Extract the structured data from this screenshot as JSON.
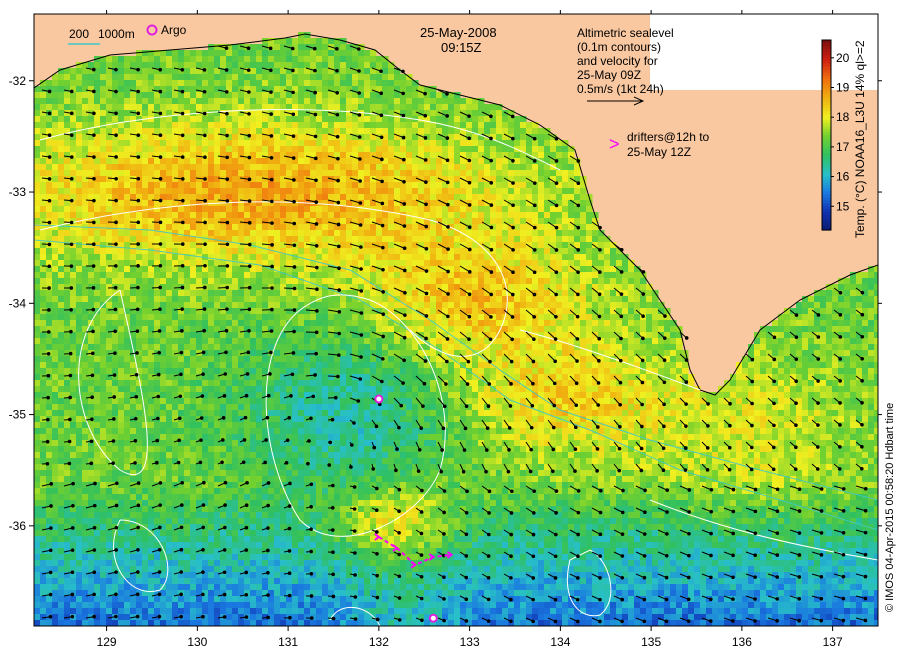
{
  "title": {
    "date": "25-May-2008",
    "time": "09:15Z"
  },
  "legend": {
    "isobaths": [
      "200",
      "1000m"
    ],
    "argo_label": "Argo",
    "altimetry_lines": [
      "Altimetric sealevel",
      "(0.1m contours)",
      "and velocity for",
      "25-May 09Z",
      "0.5m/s (1kt 24h)"
    ],
    "drifter_symbol": ">",
    "drifter_lines": [
      "drifters@12h to",
      "25-May 12Z"
    ]
  },
  "colorbar": {
    "label": "Temp. (°C) NOAA16_L3U 14% ql>=2",
    "ticks": [
      "15",
      "16",
      "17",
      "18",
      "19",
      "20"
    ],
    "min": 14.2,
    "max": 20.6
  },
  "axes": {
    "x_ticks": [
      "129",
      "130",
      "131",
      "132",
      "133",
      "134",
      "135",
      "136",
      "137"
    ],
    "y_ticks": [
      "-32",
      "-33",
      "-34",
      "-35",
      "-36"
    ],
    "lon_range": [
      128.2,
      137.5
    ],
    "lat_range": [
      -36.9,
      -31.4
    ]
  },
  "credit": "© IMOS 04-Apr-2015 00:58:20 Hdbart time",
  "colors": {
    "land": "#f9c8a0",
    "isobath": "#40c8c8",
    "contour": "#ffffff",
    "arrow": "#000000",
    "argo": "#e020e0",
    "drifter": "#ff00ff",
    "sst_palette": [
      "#0a1a6b",
      "#1030b0",
      "#1a78e0",
      "#28c0c8",
      "#30c060",
      "#70d030",
      "#f0f020",
      "#f0b010",
      "#f07010",
      "#d02010",
      "#801010"
    ]
  },
  "argo_positions": [
    [
      132.0,
      -34.86
    ],
    [
      132.6,
      -36.83
    ]
  ],
  "drifter_track": [
    [
      132.0,
      -36.1
    ],
    [
      132.2,
      -36.2
    ],
    [
      132.4,
      -36.35
    ],
    [
      132.6,
      -36.28
    ],
    [
      132.8,
      -36.26
    ]
  ]
}
